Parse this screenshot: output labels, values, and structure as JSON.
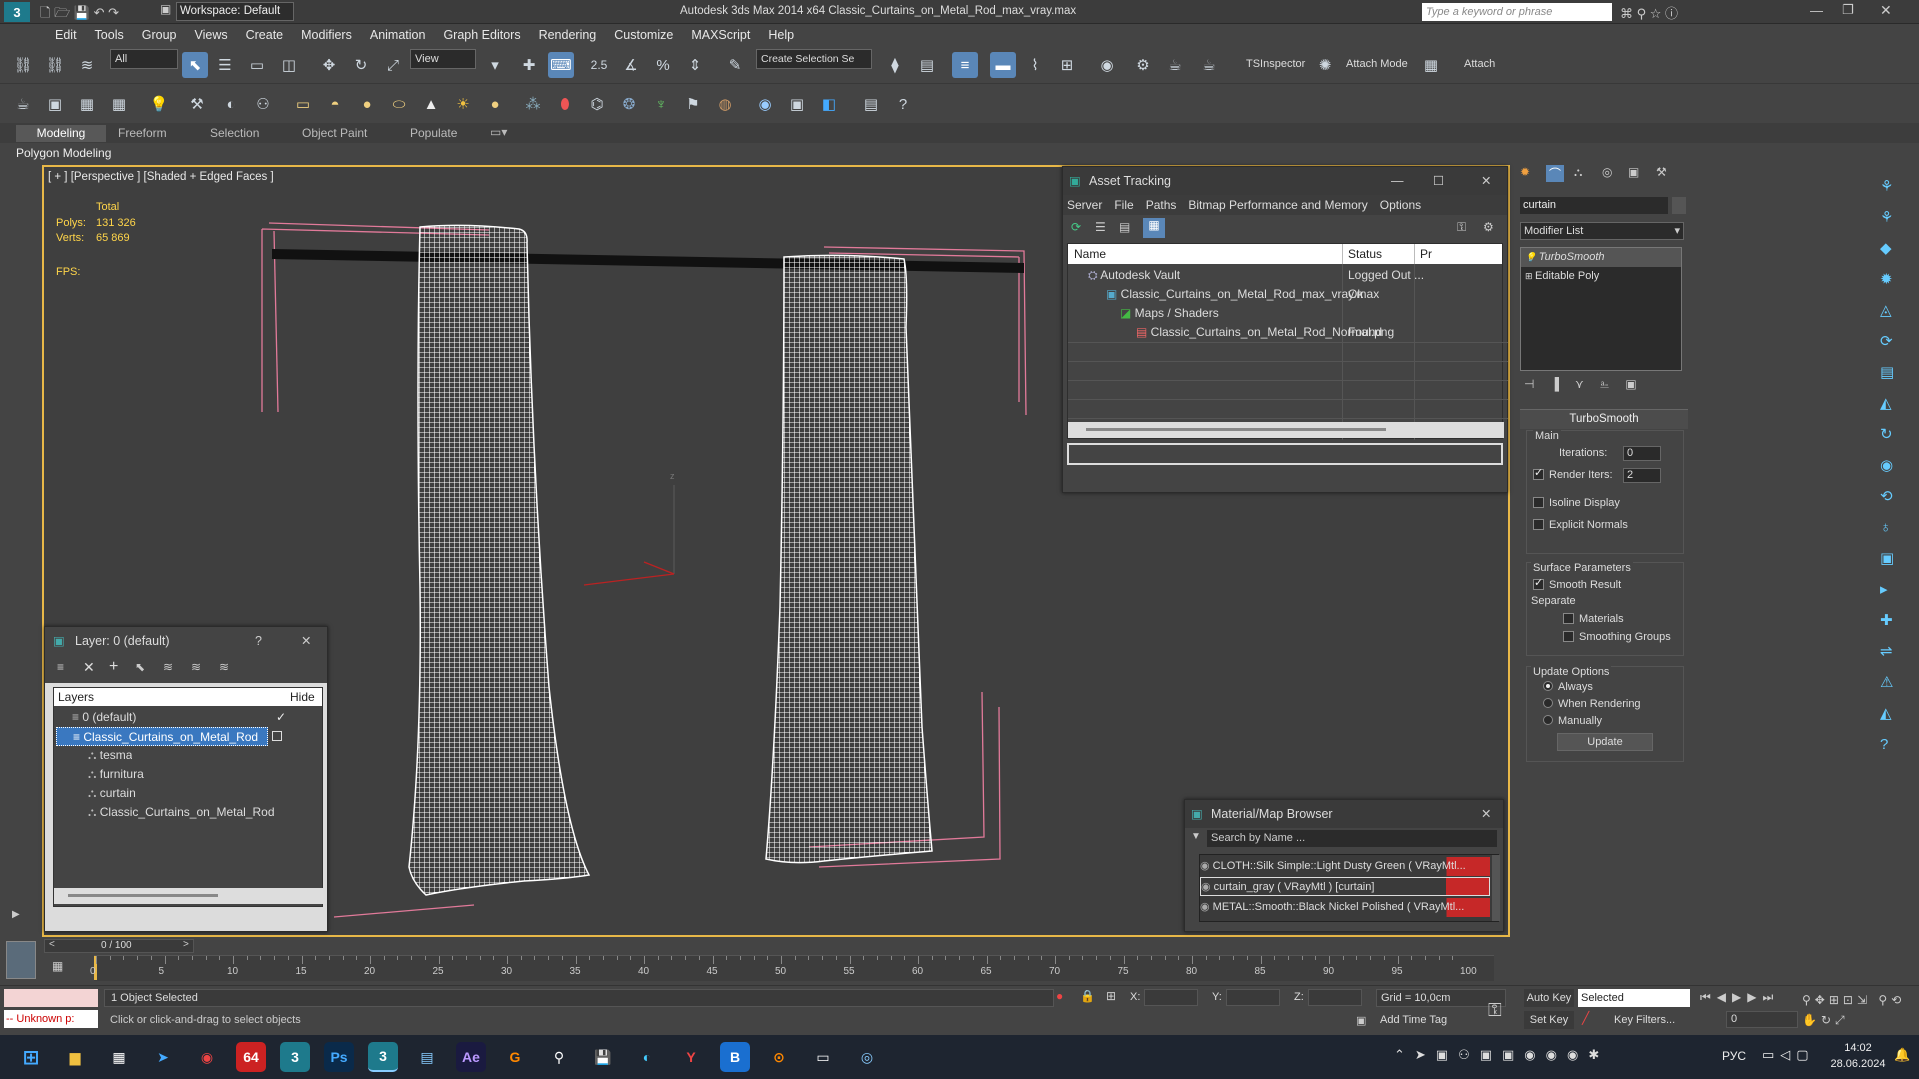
{
  "title": {
    "workspace_label": "Workspace: Default",
    "app_title": "Autodesk 3ds Max  2014 x64    Classic_Curtains_on_Metal_Rod_max_vray.max",
    "search_placeholder": "Type a keyword or phrase"
  },
  "menu": [
    "Edit",
    "Tools",
    "Group",
    "Views",
    "Create",
    "Modifiers",
    "Animation",
    "Graph Editors",
    "Rendering",
    "Customize",
    "MAXScript",
    "Help"
  ],
  "toolbar": {
    "selection_filter": "All",
    "ref_coord": "View",
    "snap_value": "2.5",
    "selection_set": "Create Selection Se",
    "tsinspector": "TSInspector",
    "attach_mode": "Attach Mode",
    "attach": "Attach"
  },
  "ribbon": {
    "tabs": [
      "Modeling",
      "Freeform",
      "Selection",
      "Object Paint",
      "Populate"
    ],
    "subtitle": "Polygon Modeling"
  },
  "viewport": {
    "label": "[ + ] [Perspective ] [Shaded + Edged Faces ]",
    "stats_total": "Total",
    "polys_label": "Polys:",
    "polys_value": "131 326",
    "verts_label": "Verts:",
    "verts_value": "65 869",
    "fps_label": "FPS:"
  },
  "asset_tracking": {
    "title": "Asset Tracking",
    "menu": [
      "Server",
      "File",
      "Paths",
      "Bitmap Performance and Memory",
      "Options"
    ],
    "columns": [
      "Name",
      "Status",
      "Pr"
    ],
    "rows": [
      {
        "name": "Autodesk Vault",
        "status": "Logged Out ..."
      },
      {
        "name": "Classic_Curtains_on_Metal_Rod_max_vray.max",
        "status": "Ok"
      },
      {
        "name": "Maps / Shaders",
        "status": ""
      },
      {
        "name": "Classic_Curtains_on_Metal_Rod_Normal.png",
        "status": "Found"
      }
    ]
  },
  "layer_panel": {
    "title": "Layer: 0 (default)",
    "help": "?",
    "col_layers": "Layers",
    "col_hide": "Hide",
    "items": [
      {
        "name": "0 (default)"
      },
      {
        "name": "Classic_Curtains_on_Metal_Rod"
      },
      {
        "name": "tesma"
      },
      {
        "name": "furnitura"
      },
      {
        "name": "curtain"
      },
      {
        "name": "Classic_Curtains_on_Metal_Rod"
      }
    ]
  },
  "material_browser": {
    "title": "Material/Map Browser",
    "search_placeholder": "Search by Name ...",
    "items": [
      "CLOTH::Silk Simple::Light Dusty Green  ( VRayMtl...",
      "curtain_gray  ( VRayMtl ) [curtain]",
      "METAL::Smooth::Black Nickel Polished  ( VRayMtl..."
    ]
  },
  "command_panel": {
    "object_name": "curtain",
    "modifier_list": "Modifier List",
    "stack": [
      "TurboSmooth",
      "Editable Poly"
    ],
    "rollout_title": "TurboSmooth",
    "main_label": "Main",
    "iterations_label": "Iterations:",
    "iterations_value": "0",
    "render_iters_label": "Render Iters:",
    "render_iters_value": "2",
    "isoline": "Isoline Display",
    "explicit_normals": "Explicit Normals",
    "surface_params": "Surface Parameters",
    "smooth_result": "Smooth Result",
    "separate": "Separate",
    "materials": "Materials",
    "smoothing_groups": "Smoothing Groups",
    "update_options": "Update Options",
    "always": "Always",
    "when_rendering": "When Rendering",
    "manually": "Manually",
    "update_btn": "Update"
  },
  "timeline": {
    "frame_label": "0 / 100",
    "ticks": [
      "0",
      "5",
      "10",
      "15",
      "20",
      "25",
      "30",
      "35",
      "40",
      "45",
      "50",
      "55",
      "60",
      "65",
      "70",
      "75",
      "80",
      "85",
      "90",
      "95",
      "100"
    ]
  },
  "status": {
    "script_listener": "-- Unknown p:",
    "selected": "1 Object Selected",
    "prompt": "Click or click-and-drag to select objects",
    "x_label": "X:",
    "y_label": "Y:",
    "z_label": "Z:",
    "grid": "Grid = 10,0cm",
    "add_time_tag": "Add Time Tag",
    "auto_key": "Auto Key",
    "set_key": "Set Key",
    "selected_dd": "Selected",
    "key_filters": "Key Filters...",
    "frame_value": "0"
  },
  "taskbar": {
    "lang": "РУС",
    "time": "14:02",
    "date": "28.06.2024"
  },
  "colors": {
    "accent_blue": "#5a87b8",
    "viewport_border": "#e8b848",
    "selection_red": "#c62828"
  }
}
